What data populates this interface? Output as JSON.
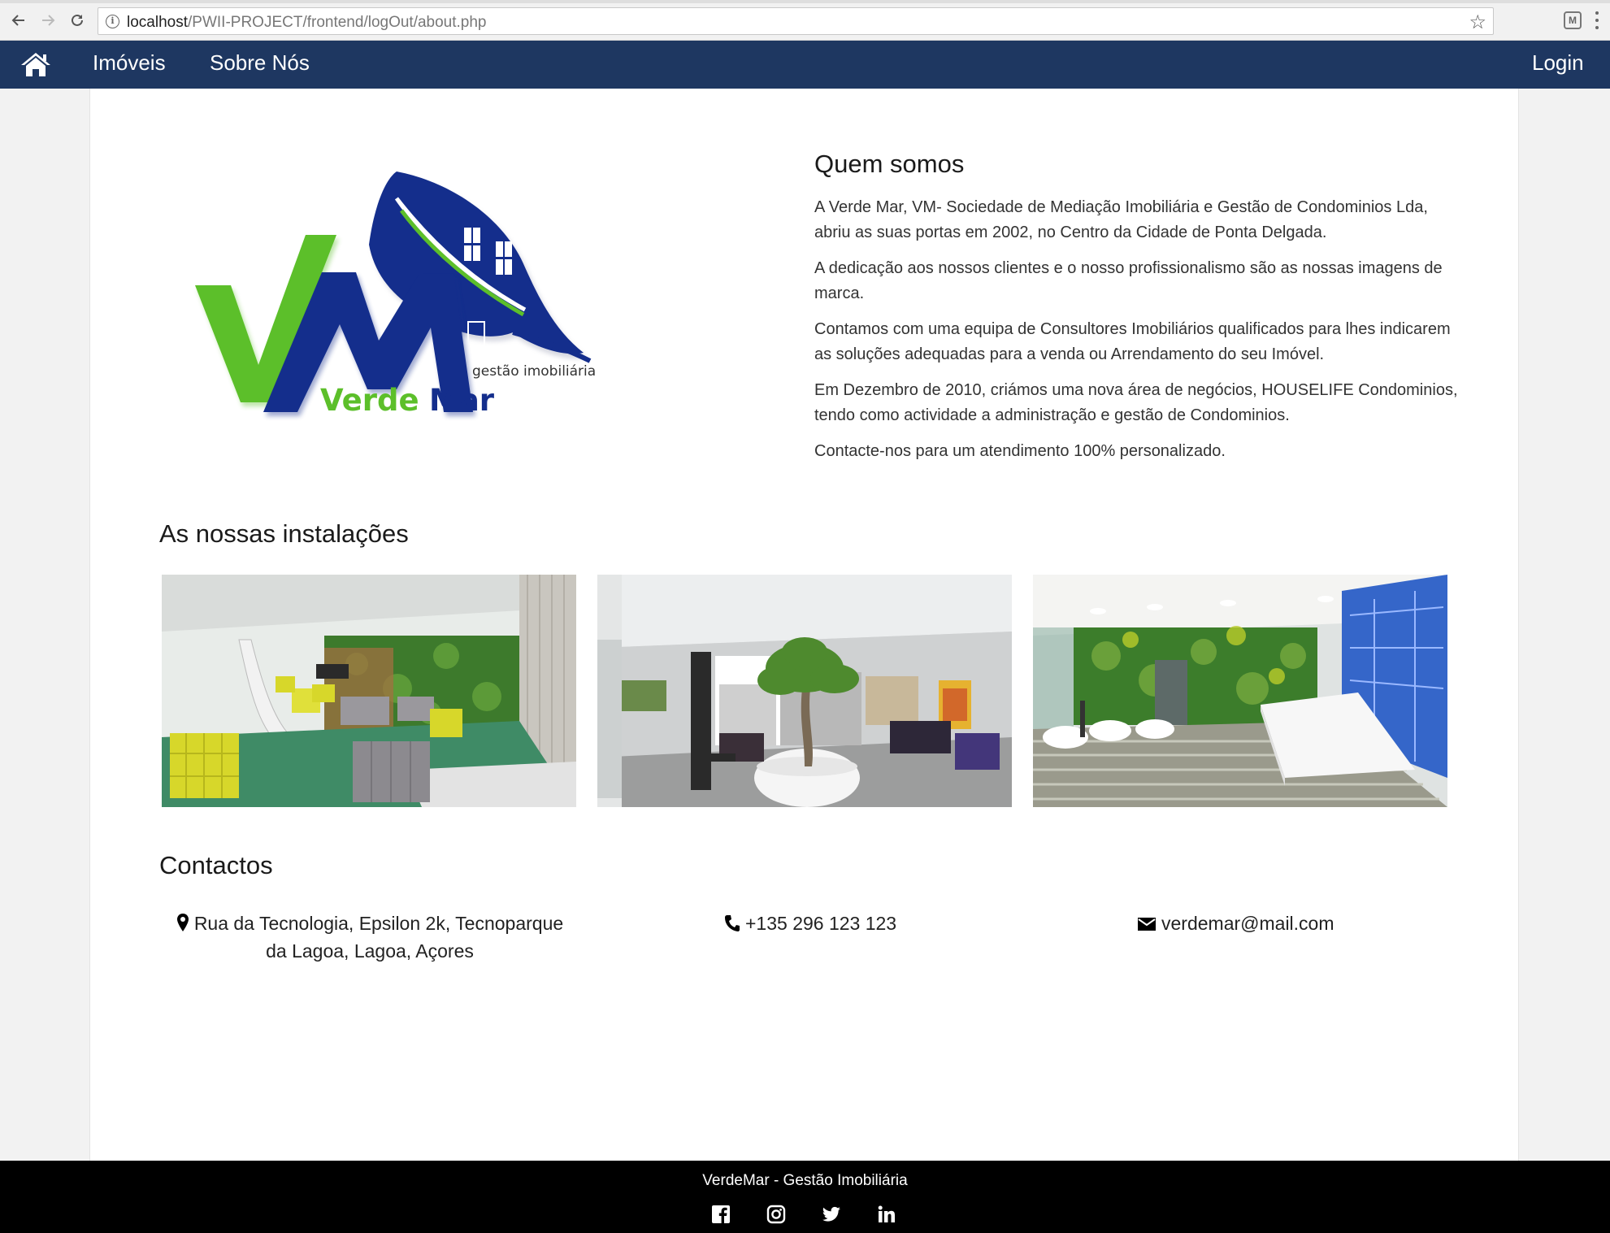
{
  "browser": {
    "url_host": "localhost",
    "url_path": "/PWII-PROJECT/frontend/logOut/about.php"
  },
  "navbar": {
    "home_icon": "home-icon",
    "items": [
      {
        "label": "Imóveis"
      },
      {
        "label": "Sobre Nós"
      }
    ],
    "login_label": "Login",
    "bg_color": "#1e3761"
  },
  "logo": {
    "letters": "VM",
    "brand_green": "Verde",
    "brand_blue": "Mar",
    "tagline": "gestão imobiliária",
    "green": "#5cbf2a",
    "blue": "#142e8c"
  },
  "about": {
    "title": "Quem somos",
    "paragraphs": [
      "A Verde Mar, VM- Sociedade de Mediação Imobiliária e Gestão de Condominios Lda, abriu as suas portas em 2002, no Centro da Cidade de Ponta Delgada.",
      "A dedicação aos nossos clientes e o nosso profissionalismo são as nossas imagens de marca.",
      "Contamos com uma equipa de Consultores Imobiliários qualificados para lhes indicarem as soluções adequadas para a venda ou Arrendamento do seu Imóvel.",
      "Em Dezembro de 2010, criámos uma nova área de negócios, HOUSELIFE Condominios, tendo como actividade a administração e gestão de Condominios.",
      "Contacte-nos para um atendimento 100% personalizado."
    ]
  },
  "facilities": {
    "title": "As nossas instalações"
  },
  "contacts": {
    "title": "Contactos",
    "address_line1": "Rua da Tecnologia, Epsilon 2k, Tecnoparque",
    "address_line2": "da Lagoa, Lagoa, Açores",
    "phone": "+135 296 123 123",
    "email": "verdemar@mail.com"
  },
  "footer": {
    "text": "VerdeMar - Gestão Imobiliária",
    "social_icons": [
      "facebook-icon",
      "instagram-icon",
      "twitter-icon",
      "linkedin-icon"
    ]
  }
}
